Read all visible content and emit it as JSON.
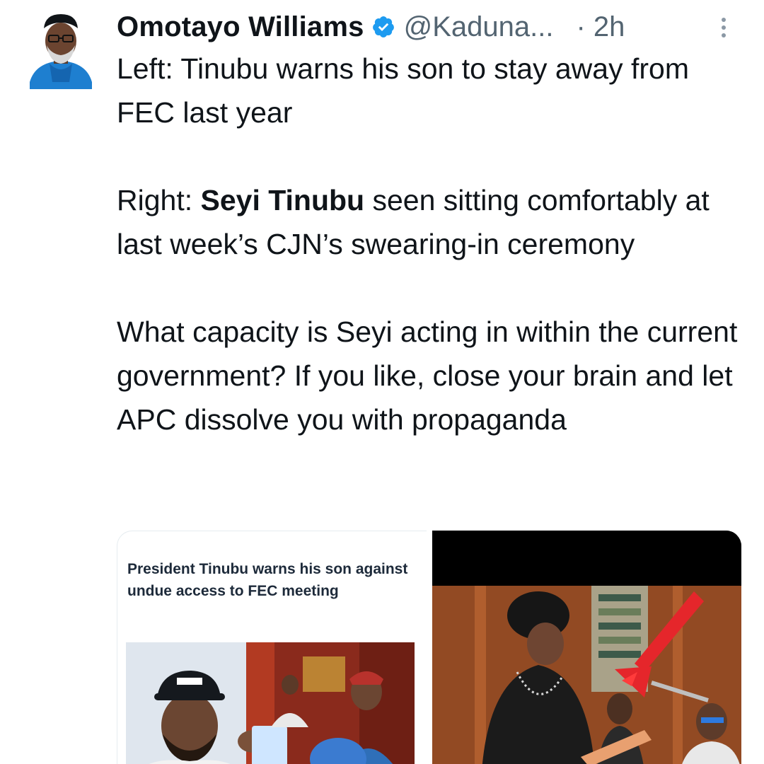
{
  "tweet": {
    "author_name": "Omotayo Williams",
    "handle": "@Kaduna...",
    "time": "· 2h",
    "paragraph1": "Left: Tinubu warns his son to stay away from FEC last year",
    "p2_prefix": "Right: ",
    "p2_bold": "Seyi Tinubu",
    "p2_rest": " seen sitting comfortably at last week’s CJN’s swearing-in ceremony",
    "paragraph3": "What capacity is Seyi acting in within the current government? If you like, close your brain and let APC dissolve you with propaganda"
  },
  "media": {
    "left_card_headline": "President Tinubu warns his son against undue access to FEC meeting"
  },
  "icons": {
    "verified": "verified-badge-icon",
    "more": "more-vertical-icon"
  },
  "colors": {
    "verified_blue": "#1d9bf0",
    "text": "#0f1419",
    "secondary": "#536471",
    "annotation_arrow": "#e5262b"
  }
}
